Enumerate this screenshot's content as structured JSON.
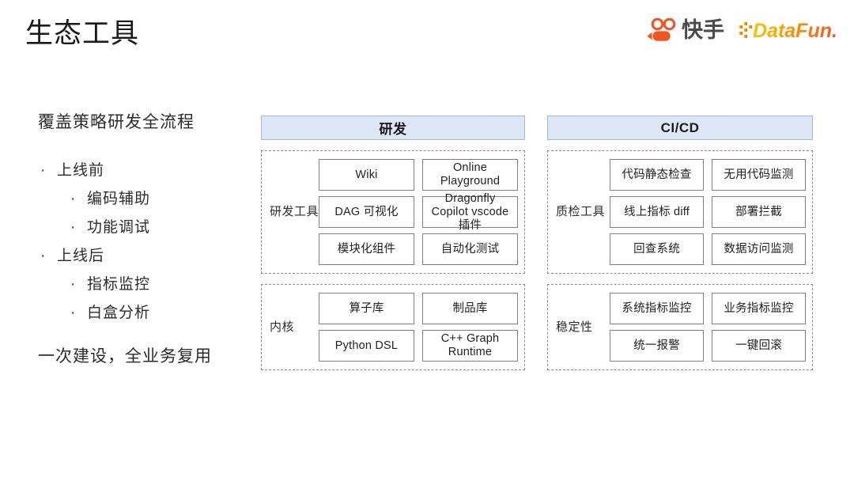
{
  "slide": {
    "title": "生态工具"
  },
  "brand": {
    "kuaishou_icon": "kuaishou-logo-icon",
    "kuaishou_word": "快手",
    "datafun_word": "DataFun.",
    "kuaishou_color": "#F25421",
    "datafun_color_start": "#FDC300",
    "datafun_color_end": "#F15A24",
    "kuaishou_word_color": "#4a4a4a"
  },
  "left": {
    "heading": "覆盖策略研发全流程",
    "bullet_glyph": "·",
    "groups": [
      {
        "label": "上线前",
        "children": [
          "编码辅助",
          "功能调试"
        ]
      },
      {
        "label": "上线后",
        "children": [
          "指标监控",
          "白盒分析"
        ]
      }
    ],
    "footer": "一次建设，全业务复用"
  },
  "panels": [
    {
      "header": "研发",
      "header_bg": "#dce6f7",
      "header_border": "#a3b7d6",
      "groups": [
        {
          "label": "研发工具",
          "cards": [
            "Wiki",
            "Online Playground",
            "DAG 可视化",
            "Dragonfly Copilot vscode 插件",
            "模块化组件",
            "自动化测试"
          ]
        },
        {
          "label": "内核",
          "cards": [
            "算子库",
            "制品库",
            "Python DSL",
            "C++ Graph Runtime"
          ]
        }
      ]
    },
    {
      "header": "CI/CD",
      "header_bg": "#dce6f7",
      "header_border": "#a3b7d6",
      "groups": [
        {
          "label": "质检工具",
          "cards": [
            "代码静态检查",
            "无用代码监测",
            "线上指标 diff",
            "部署拦截",
            "回查系统",
            "数据访问监测"
          ]
        },
        {
          "label": "稳定性",
          "cards": [
            "系统指标监控",
            "业务指标监控",
            "统一报警",
            "一键回滚"
          ]
        }
      ]
    }
  ]
}
